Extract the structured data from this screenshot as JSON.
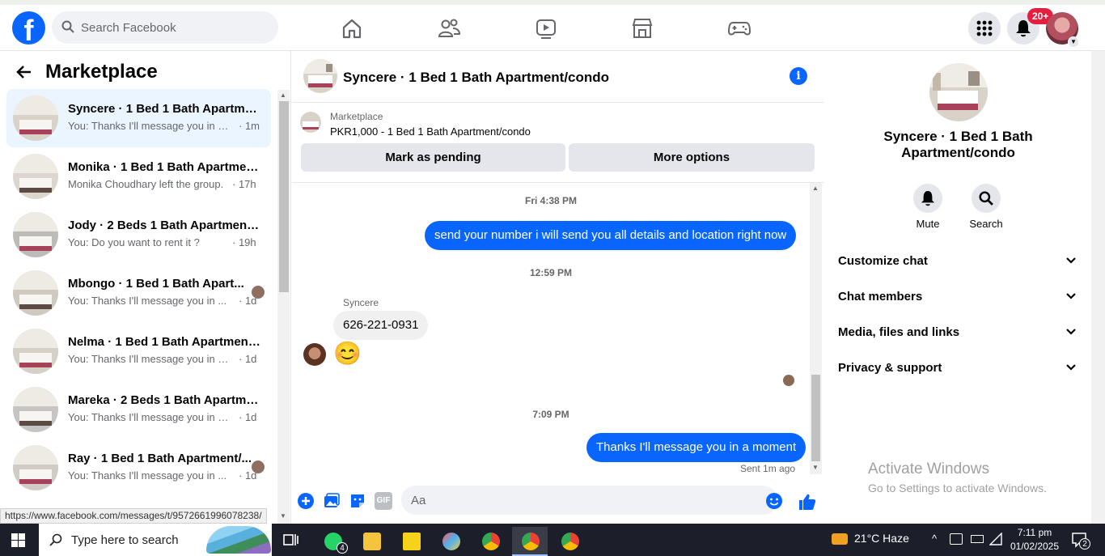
{
  "topbar": {
    "logo": "f",
    "search_placeholder": "Search Facebook",
    "nav_icons": [
      "home-icon",
      "friends-icon",
      "watch-icon",
      "marketplace-icon",
      "gaming-icon"
    ],
    "notifications_badge": "20+"
  },
  "sidebar": {
    "title": "Marketplace",
    "conversations": [
      {
        "name": "Syncere · 1 Bed 1 Bath Apartmen...",
        "preview": "You: Thanks I'll message you in a ...",
        "time": "· 1m",
        "active": true
      },
      {
        "name": "Monika · 1 Bed 1 Bath Apartmen...",
        "preview": "Monika Choudhary left the group.",
        "time": "· 17h"
      },
      {
        "name": "Jody · 2 Beds 1 Bath Apartment/...",
        "preview": "You: Do you want to rent it ?",
        "time": "· 19h"
      },
      {
        "name": "Mbongo · 1 Bed 1 Bath Apart...",
        "preview": "You: Thanks I'll message you in ...",
        "time": "· 1d",
        "seen": true
      },
      {
        "name": "Nelma · 1 Bed 1 Bath Apartment...",
        "preview": "You: Thanks I'll message you in a ...",
        "time": "· 1d"
      },
      {
        "name": "Mareka · 2 Beds 1 Bath Apartme...",
        "preview": "You: Thanks I'll message you in a ...",
        "time": "· 1d"
      },
      {
        "name": "Ray · 1 Bed 1 Bath Apartment/...",
        "preview": "You: Thanks I'll message you in ...",
        "time": "· 1d",
        "seen": true
      }
    ],
    "status_url": "https://www.facebook.com/messages/t/9572661996078238/"
  },
  "chat": {
    "title": "Syncere · 1 Bed 1 Bath Apartment/condo",
    "listing_label": "Marketplace",
    "listing_price": "PKR1,000 - 1 Bed 1 Bath Apartment/condo",
    "mark_pending": "Mark as pending",
    "more_options": "More options",
    "ts1": "Fri 4:38 PM",
    "msg1": "send your number i will send you  all details and location right now",
    "ts2": "12:59 PM",
    "sender": "Syncere",
    "msg2": "626-221-0931",
    "emoji": "😊",
    "ts3": "7:09 PM",
    "msg3": "Thanks I'll message you in a moment",
    "sent_status": "Sent 1m ago",
    "composer_placeholder": "Aa",
    "gif_label": "GIF"
  },
  "right_panel": {
    "name": "Syncere · 1 Bed 1 Bath Apartment/condo",
    "mute": "Mute",
    "search": "Search",
    "sections": [
      "Customize chat",
      "Chat members",
      "Media, files and links",
      "Privacy & support"
    ],
    "activate_title": "Activate Windows",
    "activate_sub": "Go to Settings to activate Windows."
  },
  "taskbar": {
    "search_text": "Type here to search",
    "whatsapp_badge": "4",
    "weather": "21°C  Haze",
    "time": "7:11 pm",
    "date": "01/02/2025",
    "notif_count": "2"
  },
  "colors": {
    "accent": "#0866ff",
    "bubble_in": "#f0f0f0",
    "active_conv": "#ebf5ff"
  }
}
